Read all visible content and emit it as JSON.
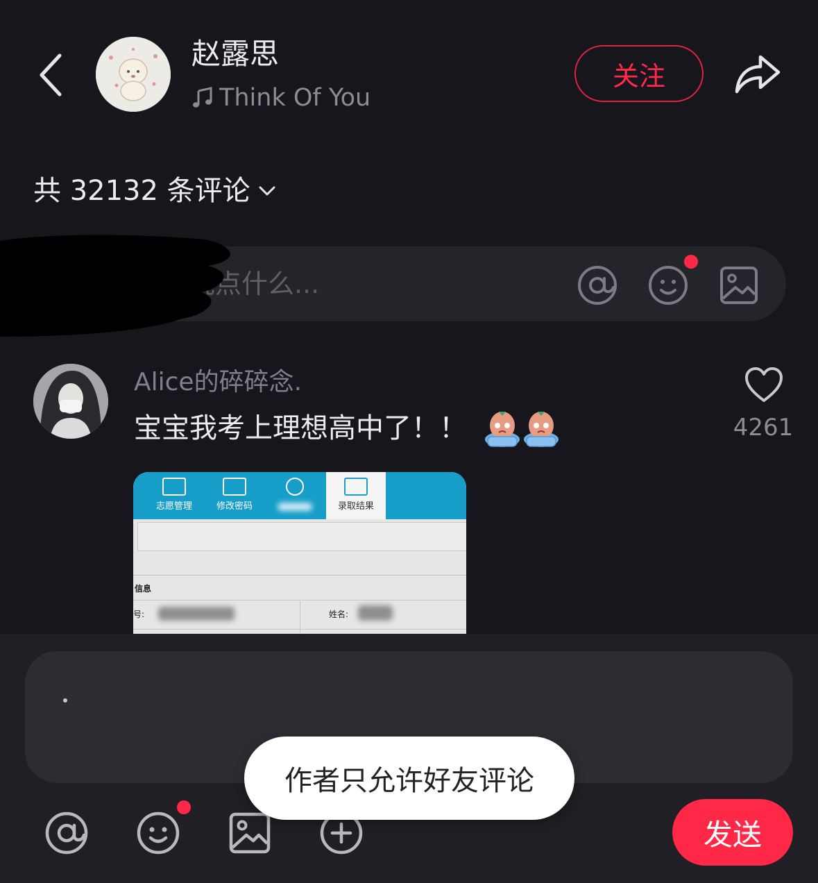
{
  "header": {
    "author_name": "赵露思",
    "song_title": "Think Of You",
    "follow_label": "关注"
  },
  "comments_header": {
    "count_label": "共 32132 条评论"
  },
  "comment_input": {
    "placeholder": "说点什么..."
  },
  "comments": [
    {
      "username": "Alice的碎碎念.",
      "text": "宝宝我考上理想高中了！！",
      "likes": "4261",
      "image": {
        "tabs": [
          "志愿管理",
          "修改密码",
          "",
          "录取结果"
        ],
        "section_label": "信息",
        "field_labels": [
          "号:",
          "姓名:"
        ]
      }
    }
  ],
  "composer": {
    "value": "·",
    "send_label": "发送"
  },
  "toast": {
    "message": "作者只允许好友评论"
  },
  "colors": {
    "background": "#16161c",
    "accent": "#ff2846",
    "composer_bg": "#201f25"
  }
}
